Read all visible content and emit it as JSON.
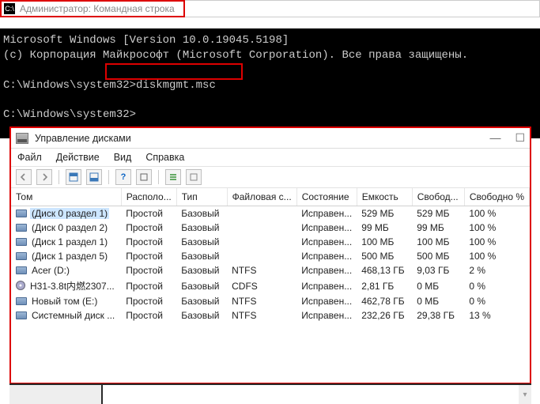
{
  "cmd": {
    "title": "Администратор: Командная строка",
    "line1": "Microsoft Windows [Version 10.0.19045.5198]",
    "line2": "(c) Корпорация Майкрософт (Microsoft Corporation). Все права защищены.",
    "blank": "",
    "prompt1_prefix": "C:\\Windows\\system32>",
    "prompt1_cmd": "diskmgmt.msc",
    "prompt2": "C:\\Windows\\system32>"
  },
  "dm": {
    "title": "Управление дисками",
    "win_controls": {
      "min": "—",
      "max": "☐"
    },
    "menu": {
      "file": "Файл",
      "action": "Действие",
      "view": "Вид",
      "help": "Справка"
    },
    "headers": {
      "tom": "Том",
      "layout": "Располо...",
      "type": "Тип",
      "fs": "Файловая с...",
      "state": "Состояние",
      "capacity": "Емкость",
      "free": "Свобод...",
      "pctfree": "Свободно %"
    },
    "rows": [
      {
        "icon": "disk",
        "name": "(Диск 0 раздел 1)",
        "layout": "Простой",
        "type": "Базовый",
        "fs": "",
        "state": "Исправен...",
        "cap": "529 МБ",
        "free": "529 МБ",
        "pct": "100 %",
        "selected": true
      },
      {
        "icon": "disk",
        "name": "(Диск 0 раздел 2)",
        "layout": "Простой",
        "type": "Базовый",
        "fs": "",
        "state": "Исправен...",
        "cap": "99 МБ",
        "free": "99 МБ",
        "pct": "100 %",
        "selected": false
      },
      {
        "icon": "disk",
        "name": "(Диск 1 раздел 1)",
        "layout": "Простой",
        "type": "Базовый",
        "fs": "",
        "state": "Исправен...",
        "cap": "100 МБ",
        "free": "100 МБ",
        "pct": "100 %",
        "selected": false
      },
      {
        "icon": "disk",
        "name": "(Диск 1 раздел 5)",
        "layout": "Простой",
        "type": "Базовый",
        "fs": "",
        "state": "Исправен...",
        "cap": "500 МБ",
        "free": "500 МБ",
        "pct": "100 %",
        "selected": false
      },
      {
        "icon": "disk",
        "name": "Acer (D:)",
        "layout": "Простой",
        "type": "Базовый",
        "fs": "NTFS",
        "state": "Исправен...",
        "cap": "468,13 ГБ",
        "free": "9,03 ГБ",
        "pct": "2 %",
        "selected": false
      },
      {
        "icon": "cd",
        "name": "H31-3.8t内燃2307...",
        "layout": "Простой",
        "type": "Базовый",
        "fs": "CDFS",
        "state": "Исправен...",
        "cap": "2,81 ГБ",
        "free": "0 МБ",
        "pct": "0 %",
        "selected": false
      },
      {
        "icon": "disk",
        "name": "Новый том (E:)",
        "layout": "Простой",
        "type": "Базовый",
        "fs": "NTFS",
        "state": "Исправен...",
        "cap": "462,78 ГБ",
        "free": "0 МБ",
        "pct": "0 %",
        "selected": false
      },
      {
        "icon": "disk",
        "name": "Системный диск ...",
        "layout": "Простой",
        "type": "Базовый",
        "fs": "NTFS",
        "state": "Исправен...",
        "cap": "232,26 ГБ",
        "free": "29,38 ГБ",
        "pct": "13 %",
        "selected": false
      }
    ]
  }
}
